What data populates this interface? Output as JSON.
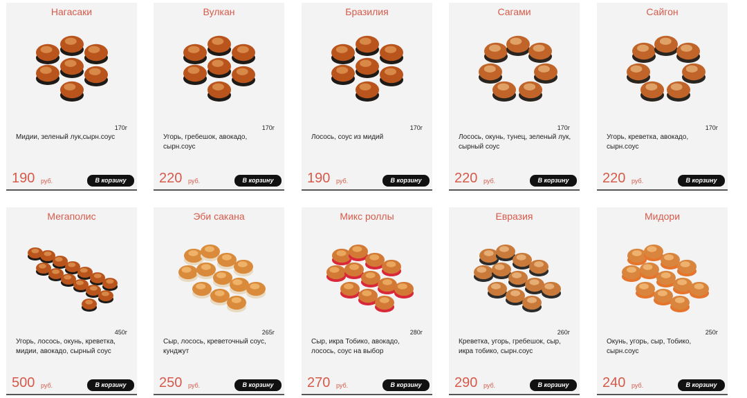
{
  "products": [
    {
      "name": "Нагасаки",
      "weight": "170г",
      "description": "Мидии, зеленый лук,сырн.соус",
      "price": "190",
      "currency": "руб.",
      "cart_label": "В корзину",
      "image": "baked-rolls-dark",
      "arrangement": "cluster"
    },
    {
      "name": "Вулкан",
      "weight": "170г",
      "description": "Угорь, гребешок, авокадо, сырн.соус",
      "price": "220",
      "currency": "руб.",
      "cart_label": "В корзину",
      "image": "baked-rolls-dark",
      "arrangement": "cluster"
    },
    {
      "name": "Бразилия",
      "weight": "170г",
      "description": "Лосось, соус из мидий",
      "price": "190",
      "currency": "руб.",
      "cart_label": "В корзину",
      "image": "baked-rolls-dark",
      "arrangement": "cluster"
    },
    {
      "name": "Сагами",
      "weight": "170г",
      "description": "Лосось, окунь, тунец, зеленый лук, сырный соус",
      "price": "220",
      "currency": "руб.",
      "cart_label": "В корзину",
      "image": "baked-rolls-light",
      "arrangement": "ring"
    },
    {
      "name": "Сайгон",
      "weight": "170г",
      "description": "Угорь, креветка, авокадо, сырн.соус",
      "price": "220",
      "currency": "руб.",
      "cart_label": "В корзину",
      "image": "baked-rolls-light",
      "arrangement": "ring"
    },
    {
      "name": "Мегаполис",
      "weight": "450г",
      "description": "Угорь, лосось, окунь, креветка, мидии, авокадо, сырный соус",
      "price": "500",
      "currency": "руб.",
      "cart_label": "В корзину",
      "image": "baked-rolls-dark",
      "arrangement": "diagonal"
    },
    {
      "name": "Эби сакана",
      "weight": "265г",
      "description": "Сыр, лосось, креветочный соус, кунджут",
      "price": "250",
      "currency": "руб.",
      "cart_label": "В корзину",
      "image": "baked-rolls-golden",
      "arrangement": "block"
    },
    {
      "name": "Микс роллы",
      "weight": "280г",
      "description": "Сыр, икра Тобико, авокадо, лосось, соус на выбор",
      "price": "270",
      "currency": "руб.",
      "cart_label": "В корзину",
      "image": "baked-rolls-red",
      "arrangement": "block"
    },
    {
      "name": "Евразия",
      "weight": "260г",
      "description": "Креветка, угорь, гребешок, сыр, икра тобико, сырн.соус",
      "price": "290",
      "currency": "руб.",
      "cart_label": "В корзину",
      "image": "baked-rolls-black",
      "arrangement": "block"
    },
    {
      "name": "Мидори",
      "weight": "250г",
      "description": "Окунь, угорь, сыр, Тобико, сырн.соус",
      "price": "240",
      "currency": "руб.",
      "cart_label": "В корзину",
      "image": "baked-rolls-orange",
      "arrangement": "block"
    }
  ],
  "colors": {
    "accent": "#d65a4a",
    "card_bg": "#f3f3f3",
    "button_bg": "#111111",
    "button_text": "#ffffff"
  }
}
